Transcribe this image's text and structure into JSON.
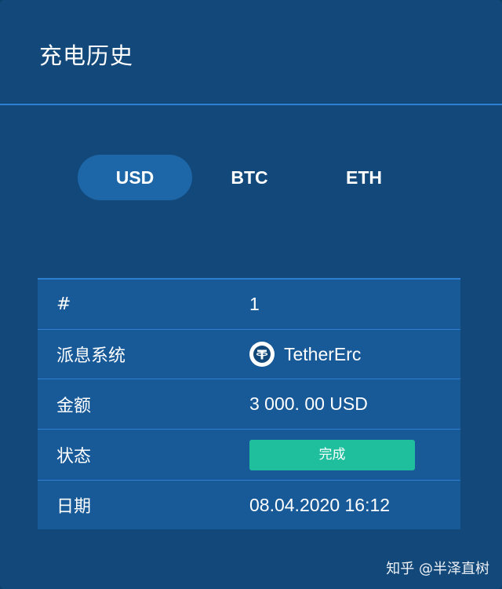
{
  "header": {
    "title": "充电历史"
  },
  "tabs": [
    {
      "label": "USD",
      "active": true
    },
    {
      "label": "BTC",
      "active": false
    },
    {
      "label": "ETH",
      "active": false
    }
  ],
  "table": {
    "rows": [
      {
        "label": "#",
        "value": "1"
      },
      {
        "label": "派息系统",
        "value": "TetherErc",
        "icon": "tether-icon"
      },
      {
        "label": "金额",
        "value": "3 000. 00 USD"
      },
      {
        "label": "状态",
        "value": "完成",
        "badge_color": "#1fbf9e"
      },
      {
        "label": "日期",
        "value": "08.04.2020 16:12"
      }
    ]
  },
  "watermark": "知乎 @半泽直树",
  "colors": {
    "background": "#13497a",
    "accent_tab": "#1d66a8",
    "table_bg": "#185a98",
    "divider": "#2f7fd0",
    "status_success": "#1fbf9e"
  }
}
